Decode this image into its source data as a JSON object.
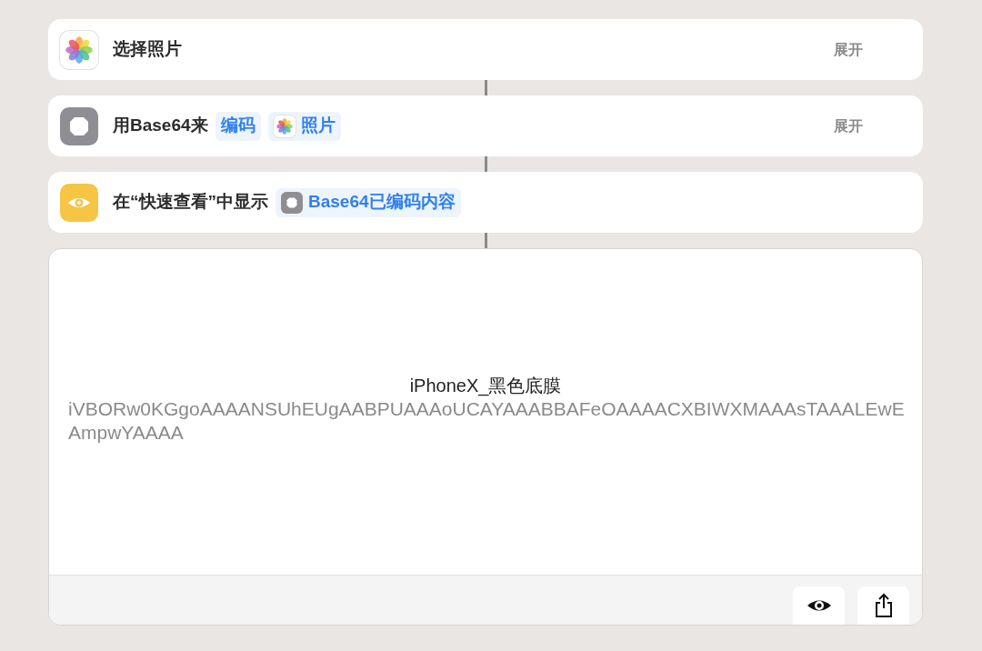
{
  "actions": [
    {
      "kind": "photos",
      "parts": [
        {
          "kind": "text",
          "text": "选择照片"
        }
      ],
      "expand": "展开"
    },
    {
      "kind": "base64",
      "parts": [
        {
          "kind": "text",
          "text": "用Base64来"
        },
        {
          "kind": "token",
          "text": "编码"
        },
        {
          "kind": "photos_token",
          "text": "照片"
        }
      ],
      "expand": "展开"
    },
    {
      "kind": "quicklook",
      "parts": [
        {
          "kind": "text",
          "text": "在“快速查看”中显示"
        },
        {
          "kind": "base64_token",
          "text": "Base64已编码内容"
        }
      ]
    }
  ],
  "preview": {
    "title": "iPhoneX_黑色底膜",
    "content": "iVBORw0KGgoAAAANSUhEUgAABPUAAAoUCAYAAABBAFeOAAAACXBIWXMAAAsTAAALEwEAmpwYAAAA",
    "buttons": [
      {
        "kind": "quicklook"
      },
      {
        "kind": "share"
      }
    ]
  }
}
